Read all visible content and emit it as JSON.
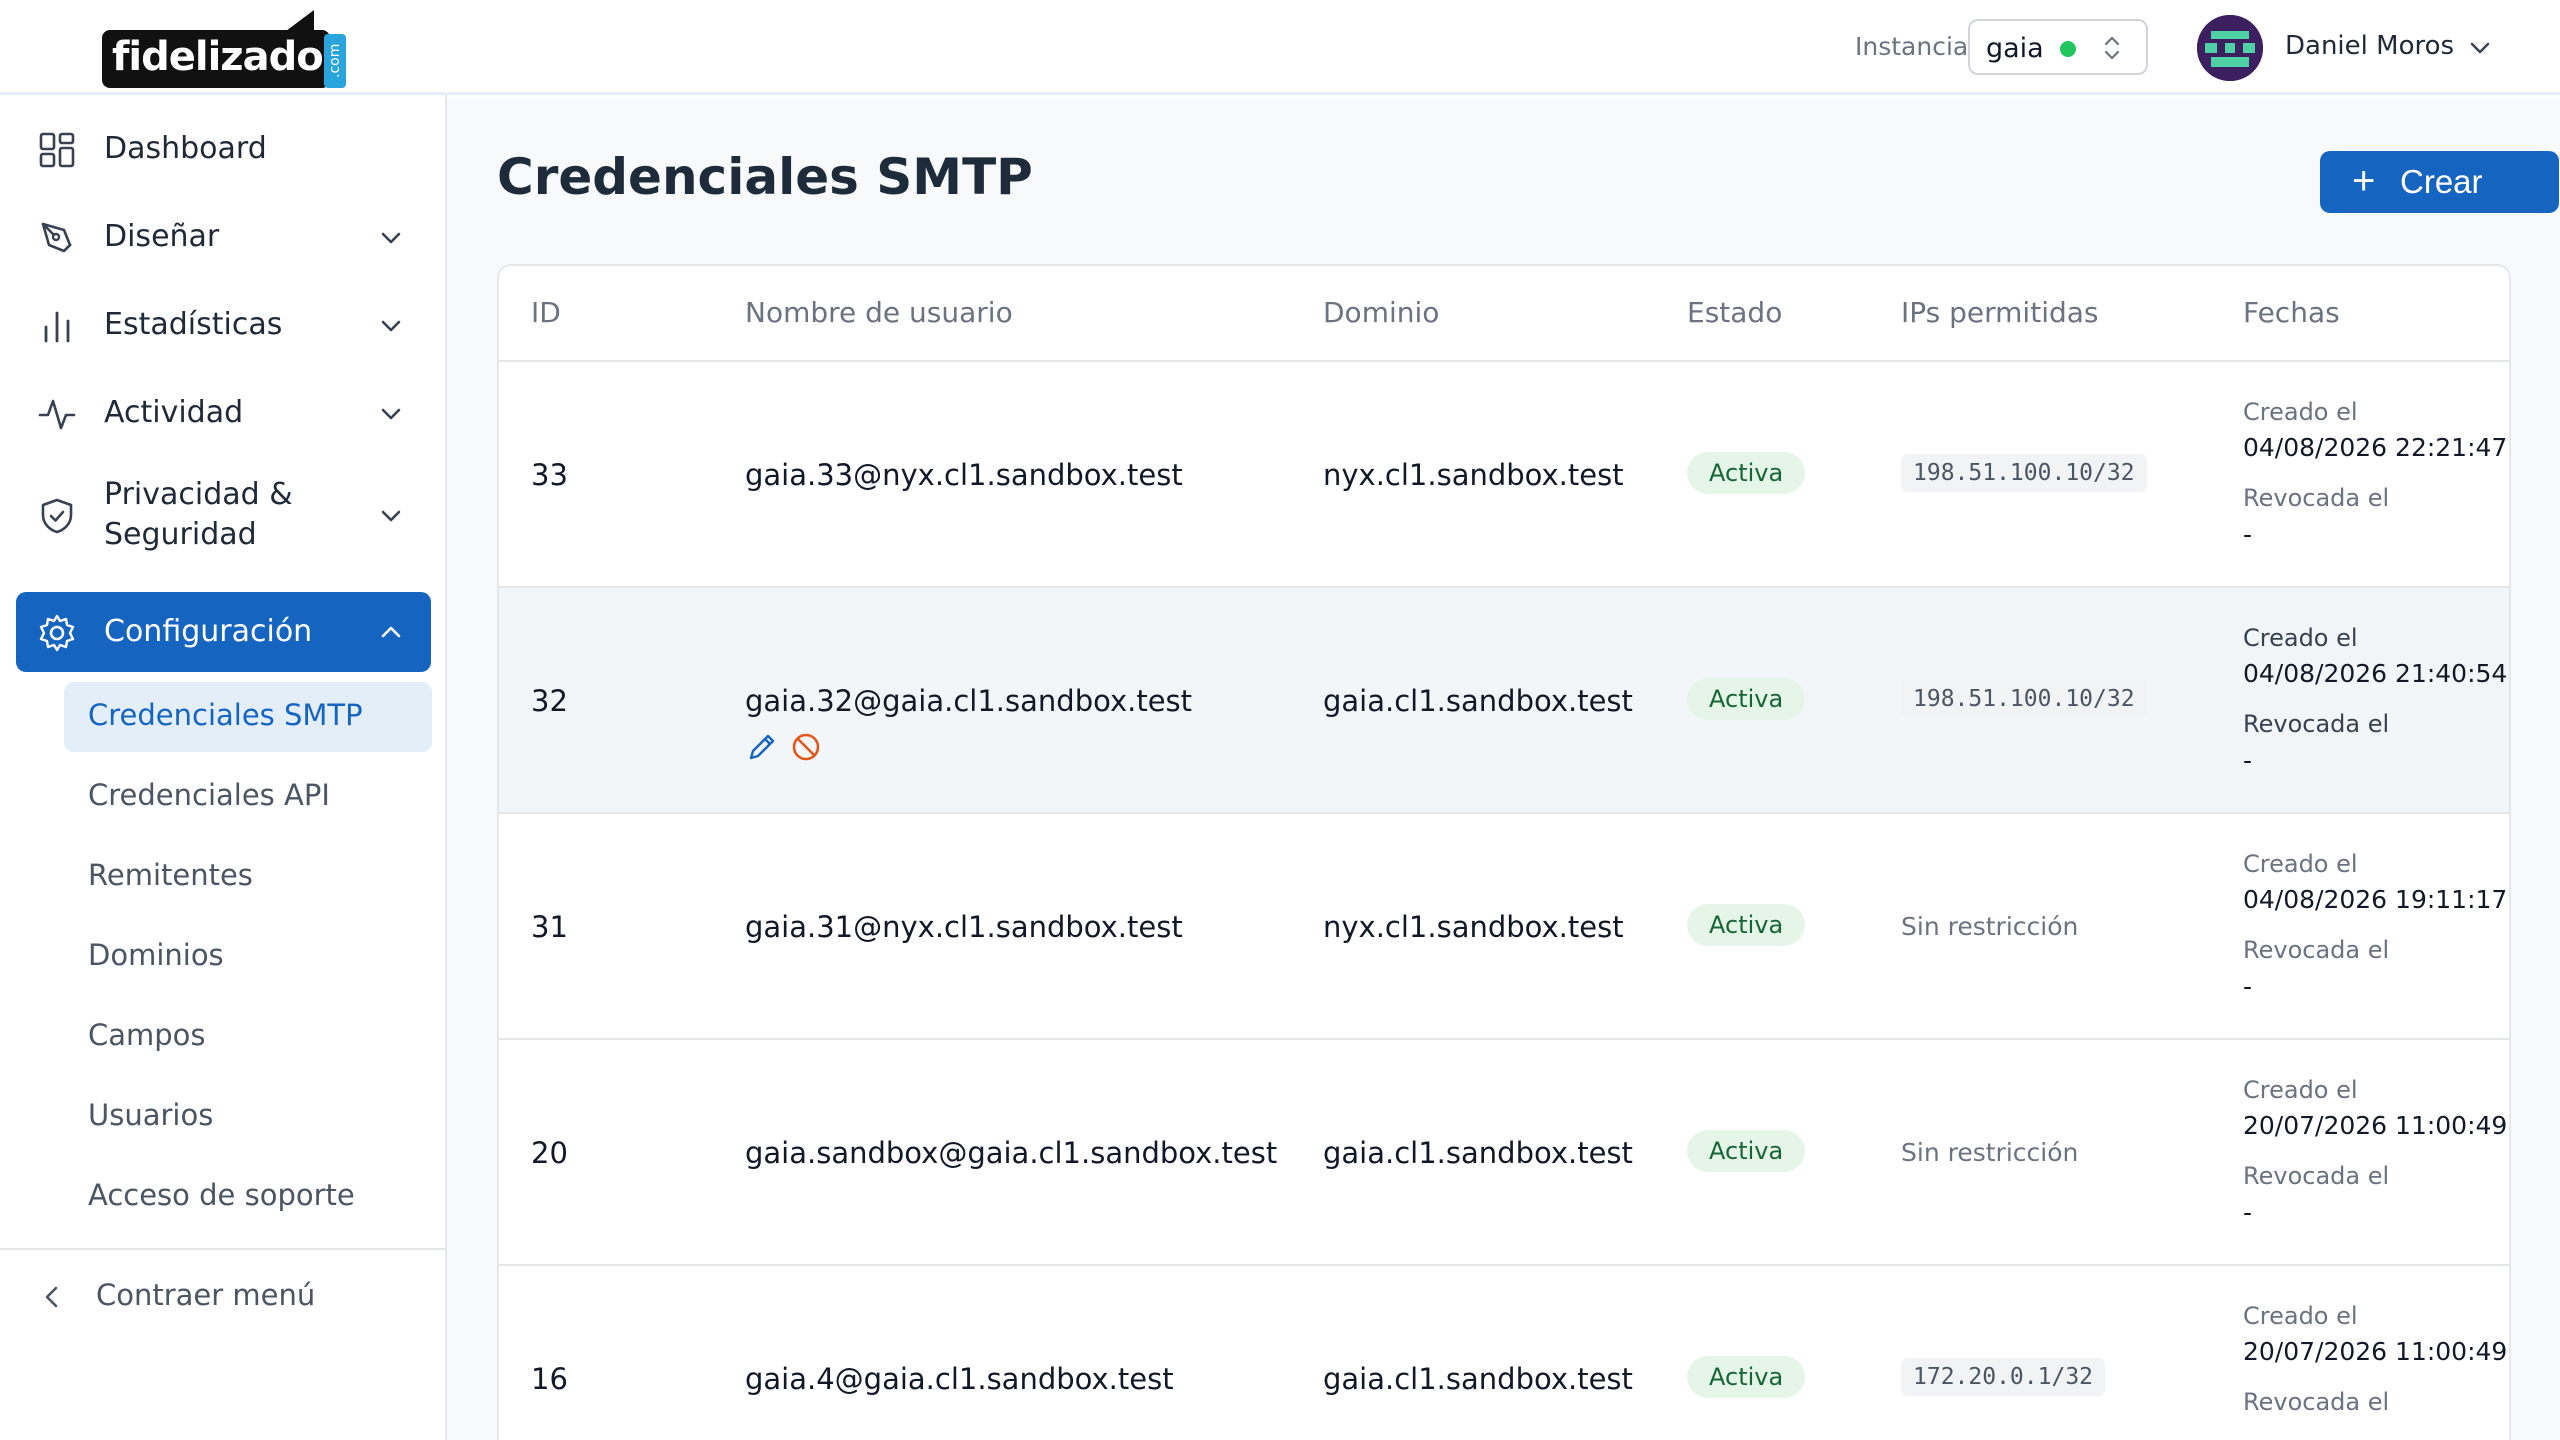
{
  "brand": {
    "logo_text": "fidelizador",
    "logo_suffix": ".com"
  },
  "header": {
    "instance_label": "Instancia",
    "instance_value": "gaia",
    "instance_status_color": "#22c55e",
    "user_name": "Daniel Moros"
  },
  "sidebar": {
    "items": [
      {
        "label": "Dashboard",
        "icon": "dashboard-icon"
      },
      {
        "label": "Diseñar",
        "icon": "pen-icon"
      },
      {
        "label": "Estadísticas",
        "icon": "bar-chart-icon"
      },
      {
        "label": "Actividad",
        "icon": "activity-icon"
      },
      {
        "label": "Privacidad &",
        "label2": "Seguridad",
        "icon": "shield-icon"
      },
      {
        "label": "Configuración",
        "icon": "gear-icon",
        "active": true
      }
    ],
    "sub_items": [
      {
        "label": "Credenciales SMTP",
        "active": true
      },
      {
        "label": "Credenciales API"
      },
      {
        "label": "Remitentes"
      },
      {
        "label": "Dominios"
      },
      {
        "label": "Campos"
      },
      {
        "label": "Usuarios"
      },
      {
        "label": "Acceso de soporte"
      }
    ],
    "collapse_label": "Contraer menú"
  },
  "main": {
    "title": "Credenciales SMTP",
    "create_label": "Crear",
    "columns": [
      "ID",
      "Nombre de usuario",
      "Dominio",
      "Estado",
      "IPs permitidas",
      "Fechas"
    ],
    "created_label": "Creado el",
    "revoked_label": "Revocada el",
    "rows": [
      {
        "id": "33",
        "username": "gaia.33@nyx.cl1.sandbox.test",
        "domain": "nyx.cl1.sandbox.test",
        "status": "Activa",
        "ips": "198.51.100.10/32",
        "created": "04/08/2026 22:21:47",
        "revoked": "-"
      },
      {
        "id": "32",
        "username": "gaia.32@gaia.cl1.sandbox.test",
        "domain": "gaia.cl1.sandbox.test",
        "status": "Activa",
        "ips": "198.51.100.10/32",
        "created": "04/08/2026 21:40:54",
        "revoked": "-"
      },
      {
        "id": "31",
        "username": "gaia.31@nyx.cl1.sandbox.test",
        "domain": "nyx.cl1.sandbox.test",
        "status": "Activa",
        "ips": "Sin restricción",
        "created": "04/08/2026 19:11:17",
        "revoked": "-"
      },
      {
        "id": "20",
        "username": "gaia.sandbox@gaia.cl1.sandbox.test",
        "domain": "gaia.cl1.sandbox.test",
        "status": "Activa",
        "ips": "Sin restricción",
        "created": "20/07/2026 11:00:49",
        "revoked": "-"
      },
      {
        "id": "16",
        "username": "gaia.4@gaia.cl1.sandbox.test",
        "domain": "gaia.cl1.sandbox.test",
        "status": "Activa",
        "ips": "172.20.0.1/32",
        "created": "20/07/2026 11:00:49",
        "revoked": ""
      }
    ]
  },
  "colors": {
    "accent": "#1565c0",
    "active_badge_bg": "#e5f6e9",
    "active_badge_text": "#166534",
    "edit_icon": "#1565c0",
    "revoke_icon": "#e0561b"
  }
}
